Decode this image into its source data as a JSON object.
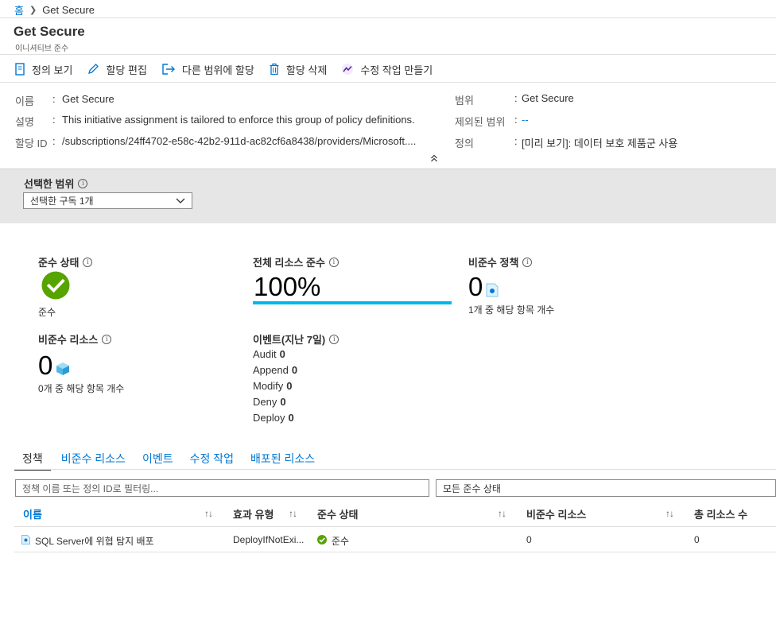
{
  "breadcrumb": {
    "home": "홈",
    "current": "Get Secure"
  },
  "header": {
    "title": "Get Secure",
    "subtitle": "이니셔티브 준수"
  },
  "toolbar": [
    {
      "label": "정의 보기",
      "icon": "document-icon"
    },
    {
      "label": "할당 편집",
      "icon": "pencil-icon"
    },
    {
      "label": "다른 범위에 할당",
      "icon": "export-icon"
    },
    {
      "label": "할당 삭제",
      "icon": "trash-icon"
    },
    {
      "label": "수정 작업 만들기",
      "icon": "remediation-icon"
    }
  ],
  "details": {
    "name_label": "이름",
    "name_value": "Get Secure",
    "desc_label": "설명",
    "desc_value": "This initiative assignment is tailored to enforce this group of policy definitions.",
    "id_label": "할당 ID",
    "id_value": "/subscriptions/24ff4702-e58c-42b2-911d-ac82cf6a8438/providers/Microsoft....",
    "scope_label": "범위",
    "scope_value": "Get Secure",
    "excluded_label": "제외된 범위",
    "excluded_value": "--",
    "definition_label": "정의",
    "definition_value": "[미리 보기]: 데이터 보호 제품군 사용",
    "colon": ":"
  },
  "scope_selector": {
    "label": "선택한 범위",
    "value": "선택한 구독 1개"
  },
  "stats": {
    "compliance_state": {
      "label": "준수 상태",
      "value": "준수"
    },
    "overall": {
      "label": "전체 리소스 준수",
      "value": "100%",
      "percent": 100
    },
    "noncompliant_policies": {
      "label": "비준수 정책",
      "value": "0",
      "sub": "1개 중 해당 항목 개수"
    },
    "noncompliant_resources": {
      "label": "비준수 리소스",
      "value": "0",
      "sub": "0개 중 해당 항목 개수"
    },
    "events": {
      "label": "이벤트(지난 7일)",
      "items": [
        {
          "name": "Audit",
          "count": "0"
        },
        {
          "name": "Append",
          "count": "0"
        },
        {
          "name": "Modify",
          "count": "0"
        },
        {
          "name": "Deny",
          "count": "0"
        },
        {
          "name": "Deploy",
          "count": "0"
        }
      ]
    }
  },
  "tabs": [
    "정책",
    "비준수 리소스",
    "이벤트",
    "수정 작업",
    "배포된 리소스"
  ],
  "filters": {
    "search_placeholder": "정책 이름 또는 정의 ID로 필터링...",
    "state_value": "모든 준수 상태"
  },
  "table": {
    "headers": [
      "이름",
      "효과 유형",
      "준수 상태",
      "비준수 리소스",
      "총 리소스 수"
    ],
    "rows": [
      {
        "name": "SQL Server에 위협 탐지 배포",
        "effect": "DeployIfNotExi...",
        "state": "준수",
        "noncompliant": "0",
        "total": "0"
      }
    ]
  },
  "colors": {
    "accent": "#0078d4",
    "success": "#57a300",
    "bar": "#00b7eb"
  }
}
